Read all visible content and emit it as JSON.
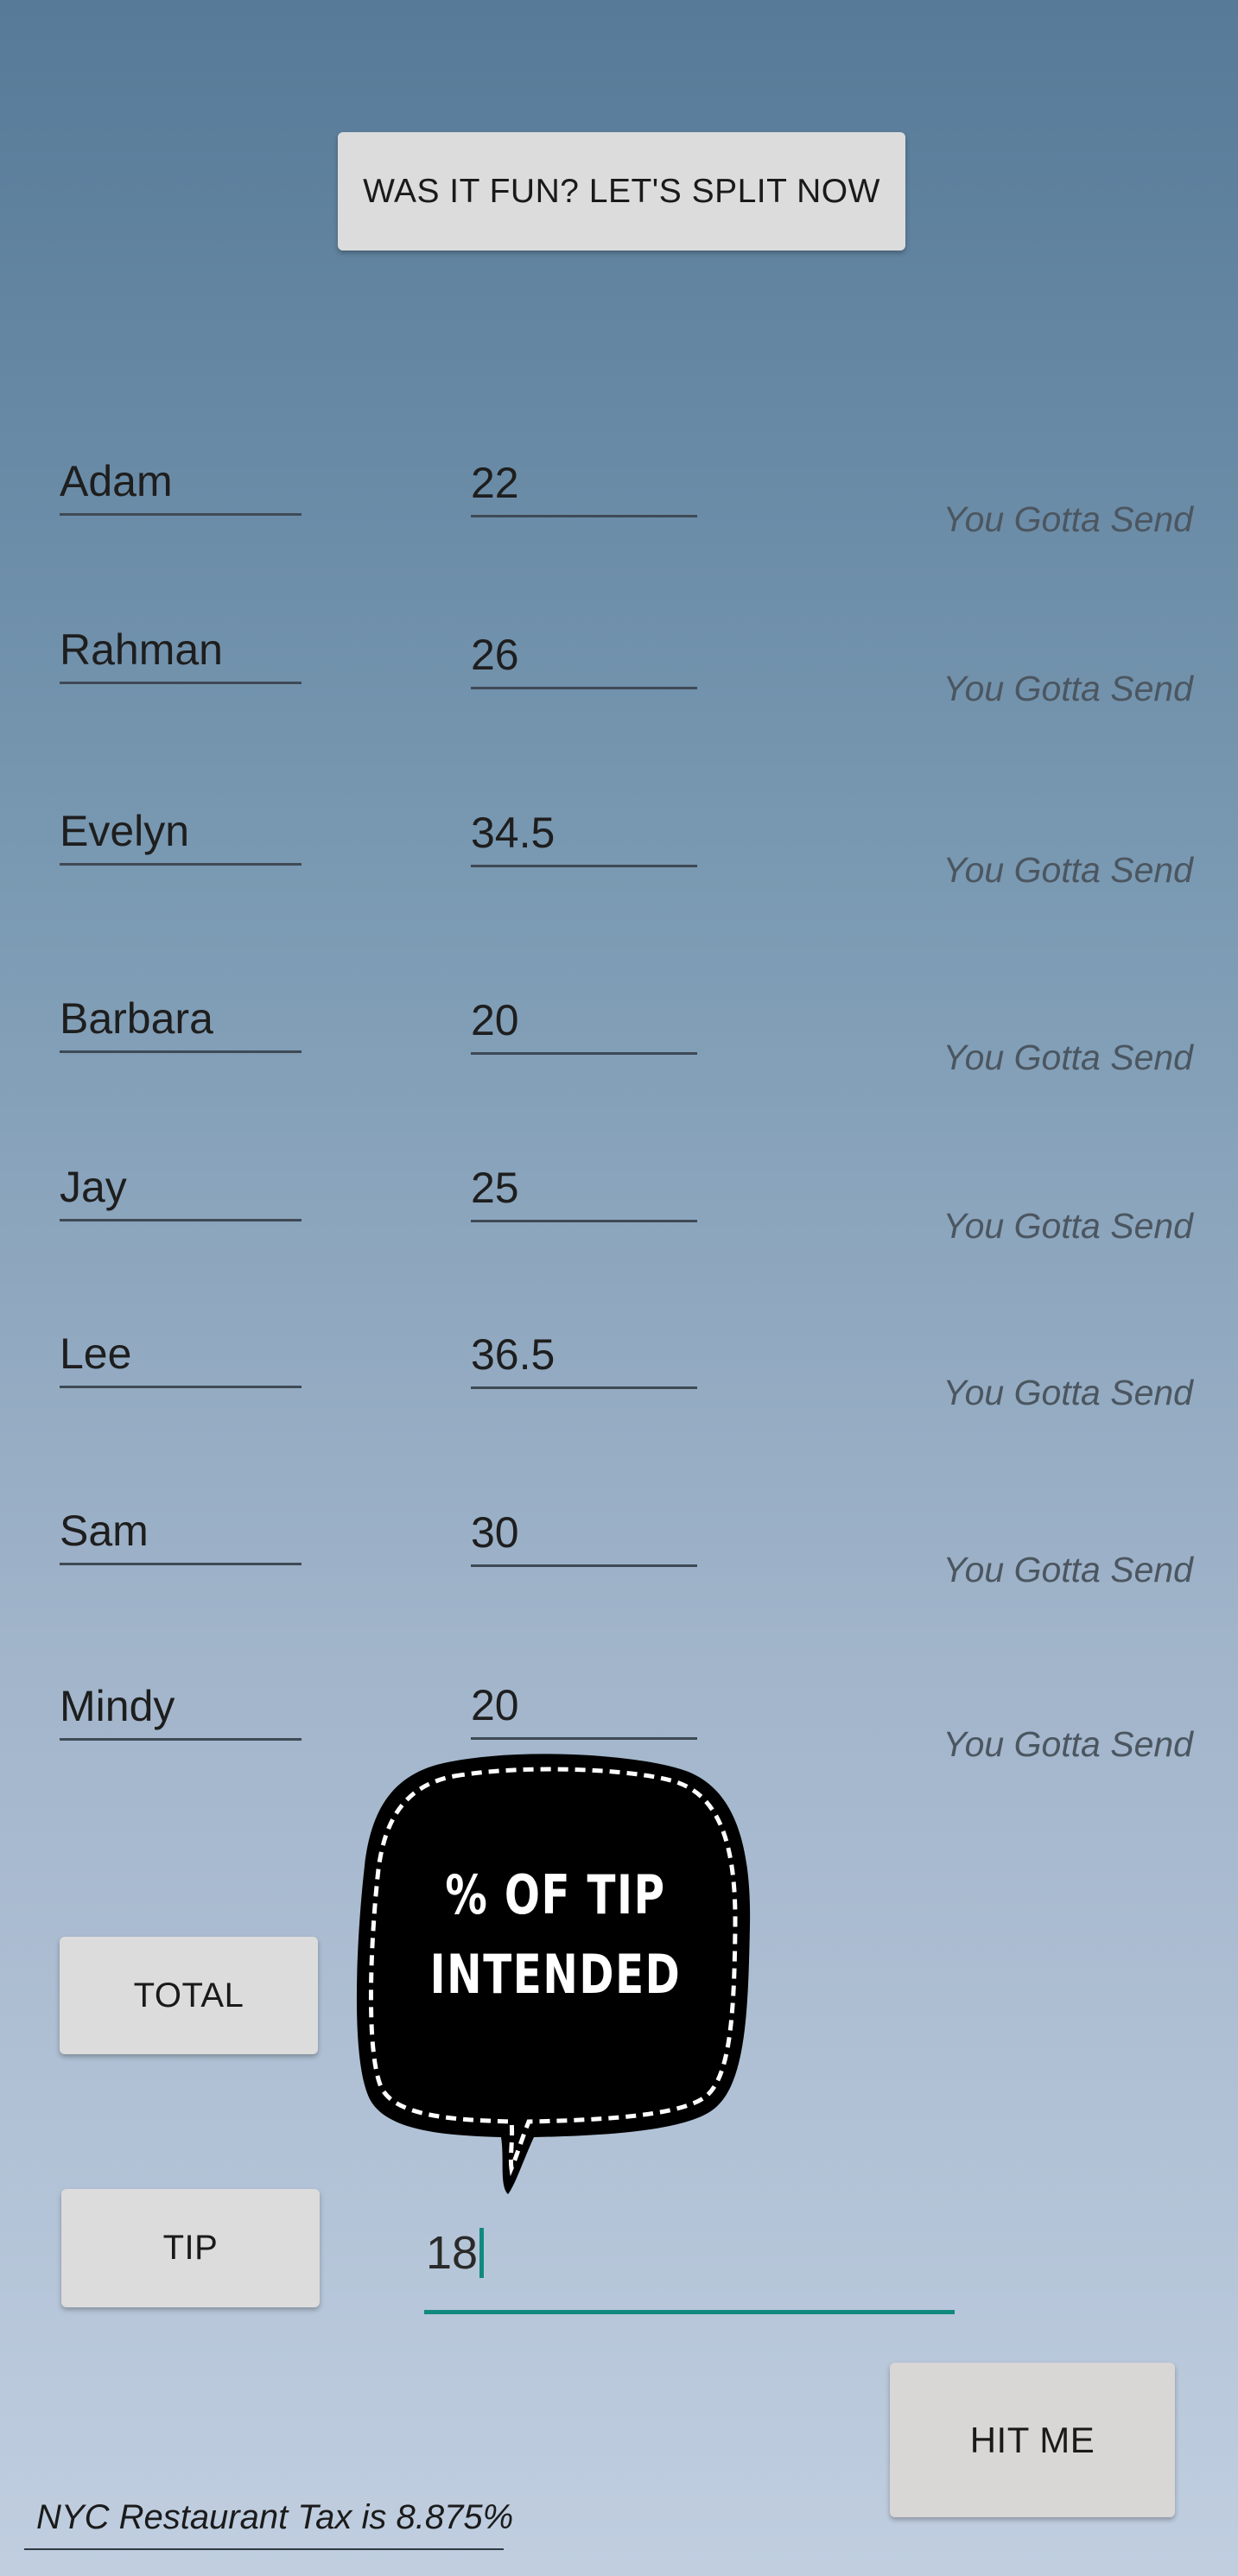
{
  "header": {
    "split_button_label": "WAS IT FUN?  LET'S SPLIT NOW"
  },
  "people": [
    {
      "name": "Adam",
      "amount": "22",
      "send_label": "You Gotta Send"
    },
    {
      "name": "Rahman",
      "amount": "26",
      "send_label": "You Gotta Send"
    },
    {
      "name": "Evelyn",
      "amount": "34.5",
      "send_label": "You Gotta Send"
    },
    {
      "name": "Barbara",
      "amount": "20",
      "send_label": "You Gotta Send"
    },
    {
      "name": "Jay",
      "amount": "25",
      "send_label": "You Gotta Send"
    },
    {
      "name": "Lee",
      "amount": "36.5",
      "send_label": "You Gotta Send"
    },
    {
      "name": "Sam",
      "amount": "30",
      "send_label": "You Gotta Send"
    },
    {
      "name": "Mindy",
      "amount": "20",
      "send_label": "You Gotta Send"
    }
  ],
  "controls": {
    "total_label": "TOTAL",
    "tip_label": "TIP",
    "tip_value": "18",
    "hit_label": "HIT ME"
  },
  "bubble": {
    "line1": "% OF TIP",
    "line2": "INTENDED"
  },
  "footer": {
    "tax_note": "NYC Restaurant Tax is 8.875%"
  },
  "colors": {
    "accent": "#11897f",
    "button_bg": "#dcdcdc",
    "bubble_bg": "#000000"
  }
}
